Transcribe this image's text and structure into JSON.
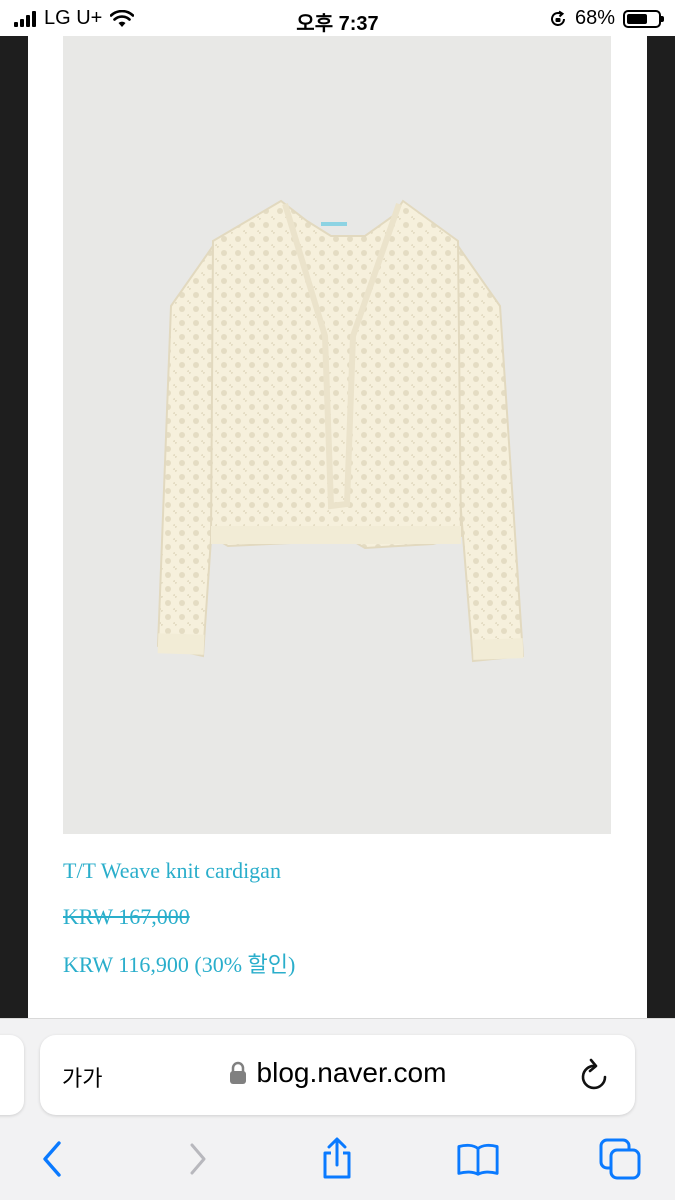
{
  "status_bar": {
    "carrier": "LG U+",
    "time": "오후 7:37",
    "battery_percent": "68%",
    "battery_level": 0.68
  },
  "product": {
    "title": "T/T Weave knit cardigan",
    "original_price": "KRW 167,000",
    "sale_price": "KRW 116,900 (30% 할인)",
    "image_icon": "cream-knit-cardigan-photo"
  },
  "browser": {
    "reader_label": "가가",
    "url": "blog.naver.com",
    "toolbar": {
      "back_icon": "chevron-left-icon",
      "forward_icon": "chevron-right-icon",
      "share_icon": "share-icon",
      "bookmarks_icon": "book-icon",
      "tabs_icon": "tabs-icon"
    }
  },
  "colors": {
    "accent": "#2aaecb",
    "ios_blue": "#0a7aff",
    "photo_background": "#e8e8e6",
    "garment": "#f6f0dc"
  }
}
